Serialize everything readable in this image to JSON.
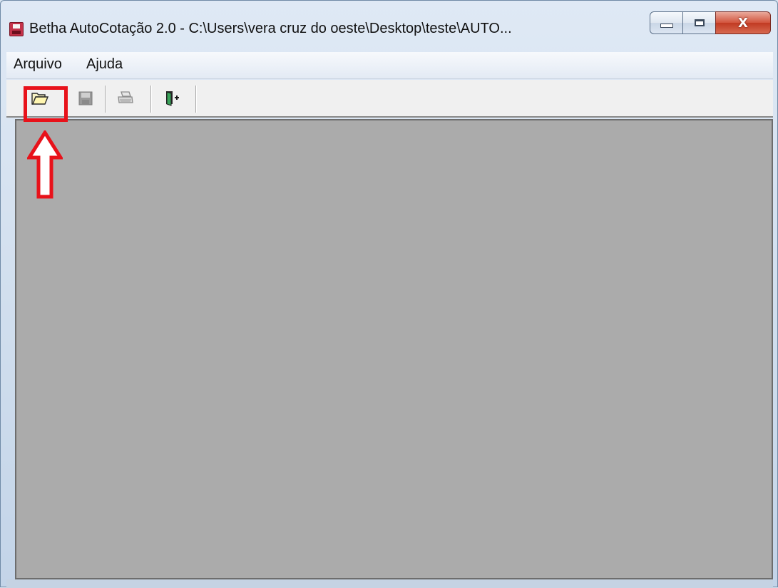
{
  "window": {
    "title": "Betha AutoCotação 2.0 - C:\\Users\\vera cruz  do oeste\\Desktop\\teste\\AUTO...",
    "controls": {
      "minimize_icon": "minimize-icon",
      "maximize_icon": "maximize-icon",
      "close_glyph": "X"
    }
  },
  "menubar": {
    "items": [
      {
        "label": "Arquivo"
      },
      {
        "label": "Ajuda"
      }
    ]
  },
  "toolbar": {
    "buttons": [
      {
        "icon": "open-folder-icon",
        "enabled": true,
        "highlighted": true
      },
      {
        "icon": "save-icon",
        "enabled": false
      },
      {
        "icon": "print-icon",
        "enabled": false
      },
      {
        "icon": "exit-door-icon",
        "enabled": true
      }
    ]
  },
  "annotation": {
    "highlight_color": "#e8121a",
    "arrow_icon": "up-arrow-icon"
  },
  "colors": {
    "client_area": "#ababab",
    "toolbar": "#f0f0f0"
  }
}
